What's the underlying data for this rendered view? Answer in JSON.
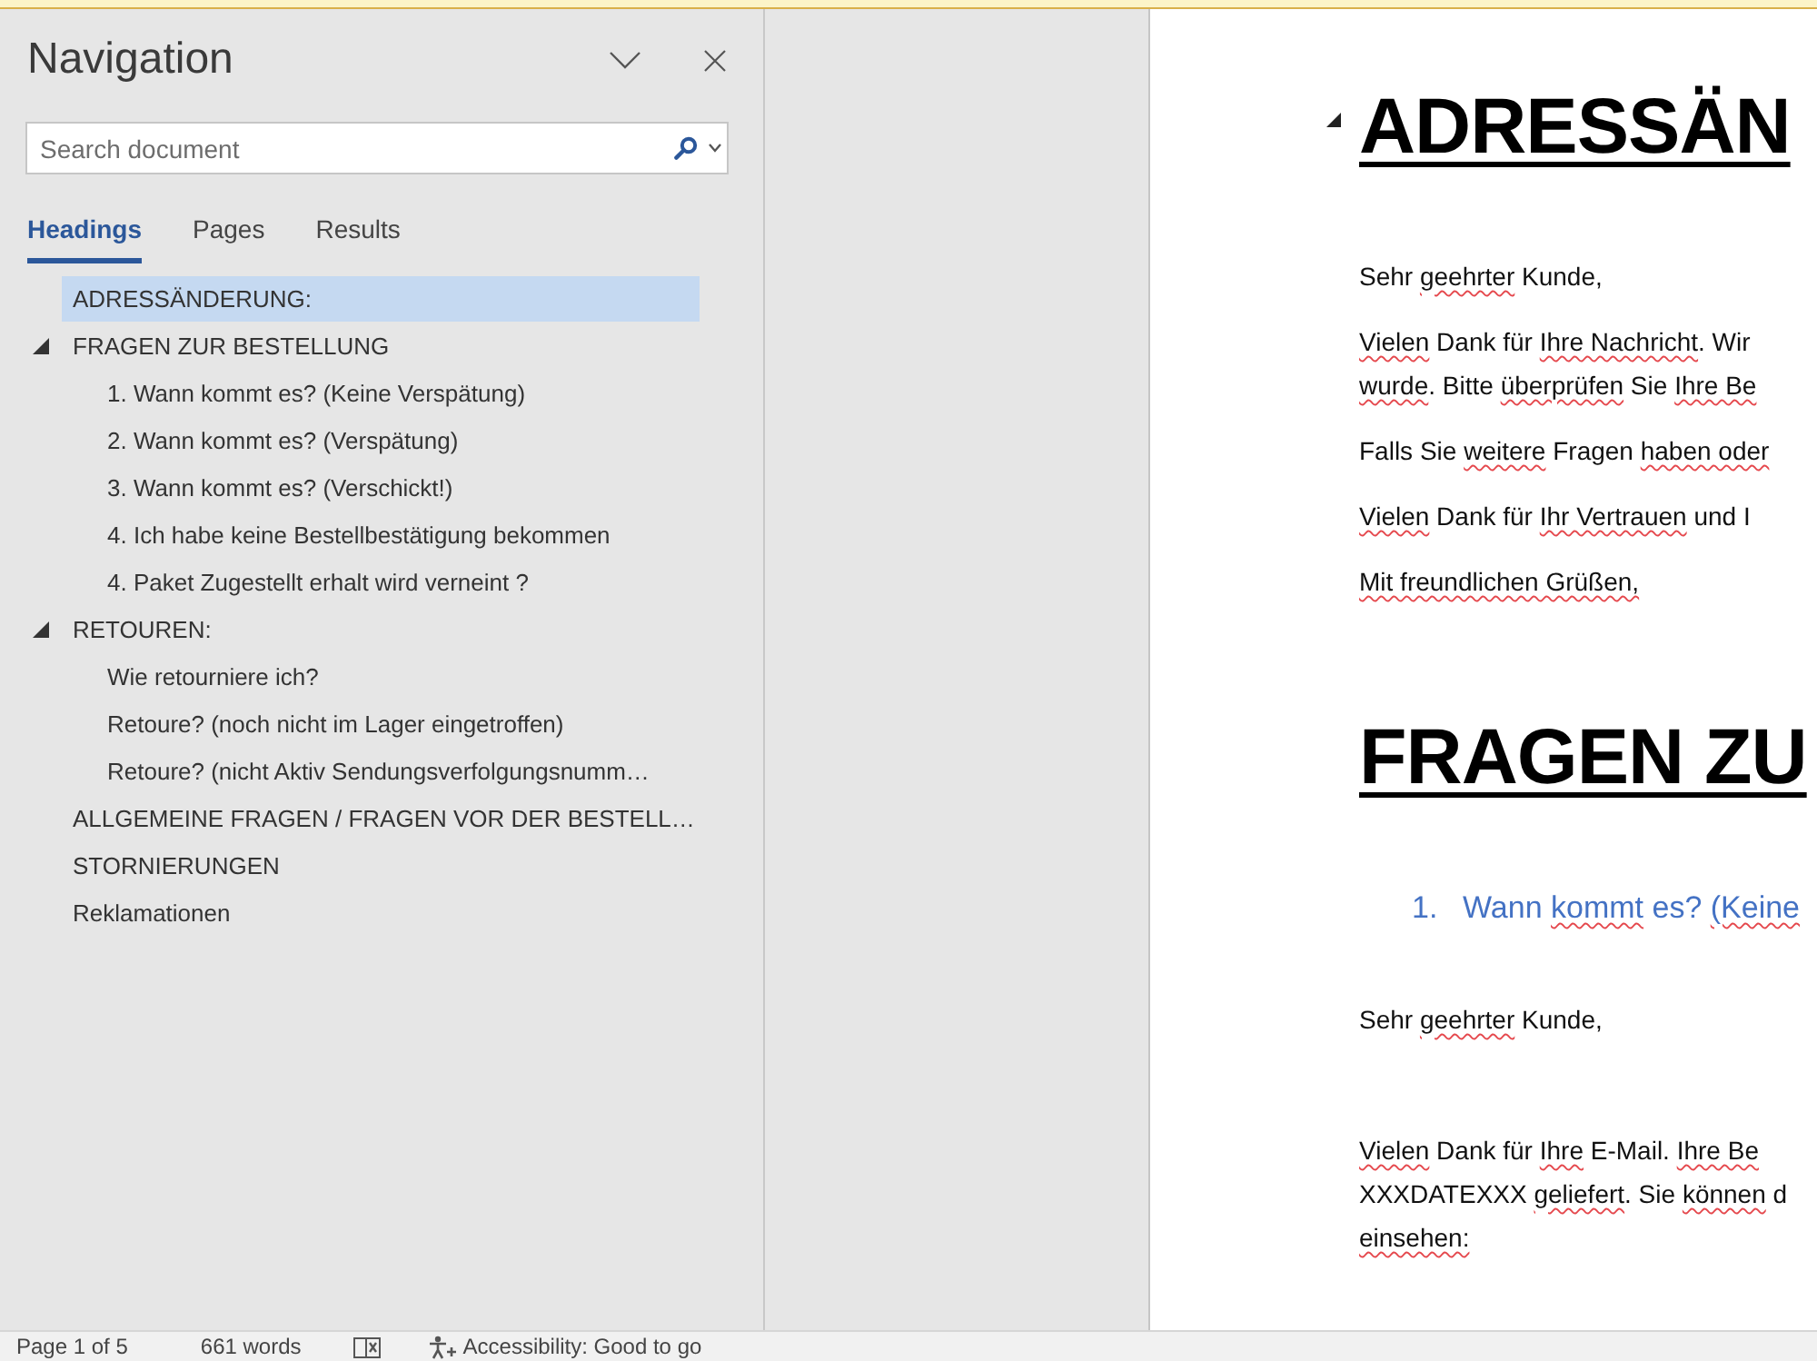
{
  "navigation": {
    "title": "Navigation",
    "search": {
      "placeholder": "Search document"
    },
    "tabs": [
      {
        "label": "Headings",
        "selected": true
      },
      {
        "label": "Pages",
        "selected": false
      },
      {
        "label": "Results",
        "selected": false
      }
    ],
    "headings": [
      {
        "text": "ADRESSÄNDERUNG:",
        "selected": true
      },
      {
        "text": "FRAGEN ZUR BESTELLUNG",
        "selected": false,
        "expanded": true,
        "children": [
          {
            "text": "1. Wann kommt es? (Keine Verspätung)",
            "selected": false
          },
          {
            "text": "2. Wann kommt es? (Verspätung)",
            "selected": false
          },
          {
            "text": "3. Wann kommt es? (Verschickt!)",
            "selected": false
          },
          {
            "text": "4. Ich habe keine Bestellbestätigung bekommen",
            "selected": false
          },
          {
            "text": "4. Paket Zugestellt erhalt wird verneint ?",
            "selected": false
          }
        ]
      },
      {
        "text": "RETOUREN:",
        "selected": false,
        "expanded": true,
        "children": [
          {
            "text": "Wie retourniere ich?",
            "selected": false
          },
          {
            "text": "Retoure? (noch nicht im Lager eingetroffen)",
            "selected": false
          },
          {
            "text": "Retoure? (nicht Aktiv Sendungsverfolgungsnumm…",
            "selected": false
          }
        ]
      },
      {
        "text": "ALLGEMEINE FRAGEN / FRAGEN VOR DER BESTELL…",
        "selected": false
      },
      {
        "text": "STORNIERUNGEN",
        "selected": false
      },
      {
        "text": "Reklamationen",
        "selected": false
      }
    ]
  },
  "document": {
    "blocks": [
      {
        "kind": "heading",
        "text": "ADRESSÄN",
        "collapse_arrow": true
      },
      {
        "kind": "paragraph",
        "blank_line_before": false,
        "lines": [
          [
            {
              "text": "Sehr ",
              "spelling_error": false
            },
            {
              "text": "geehrter",
              "spelling_error": true
            },
            {
              "text": " Kunde,",
              "spelling_error": false
            }
          ]
        ]
      },
      {
        "kind": "paragraph",
        "blank_line_before": false,
        "lines": [
          [
            {
              "text": "Vielen",
              "spelling_error": true
            },
            {
              "text": " Dank für ",
              "spelling_error": false
            },
            {
              "text": "Ihre Nachricht",
              "spelling_error": true
            },
            {
              "text": ". Wir",
              "spelling_error": false
            }
          ],
          [
            {
              "text": "wurde",
              "spelling_error": true
            },
            {
              "text": ". Bitte ",
              "spelling_error": false
            },
            {
              "text": "überprüfen",
              "spelling_error": true
            },
            {
              "text": " Sie ",
              "spelling_error": false
            },
            {
              "text": "Ihre Be",
              "spelling_error": true
            }
          ]
        ]
      },
      {
        "kind": "paragraph",
        "blank_line_before": false,
        "lines": [
          [
            {
              "text": "Falls Sie ",
              "spelling_error": false
            },
            {
              "text": "weitere",
              "spelling_error": true
            },
            {
              "text": " Fragen ",
              "spelling_error": false
            },
            {
              "text": "haben oder",
              "spelling_error": true
            }
          ]
        ]
      },
      {
        "kind": "paragraph",
        "blank_line_before": false,
        "lines": [
          [
            {
              "text": "Vielen",
              "spelling_error": true
            },
            {
              "text": " Dank für ",
              "spelling_error": false
            },
            {
              "text": "Ihr Vertrauen",
              "spelling_error": true
            },
            {
              "text": " und I",
              "spelling_error": false
            }
          ]
        ]
      },
      {
        "kind": "paragraph",
        "blank_line_before": false,
        "lines": [
          [
            {
              "text": "Mit freundlichen Grüßen,",
              "spelling_error": true
            }
          ]
        ]
      },
      {
        "kind": "heading",
        "text": "FRAGEN ZU",
        "collapse_arrow": false
      },
      {
        "kind": "numbered_heading",
        "number": "1.",
        "runs": [
          {
            "text": "Wann ",
            "spelling_error": false
          },
          {
            "text": "kommt",
            "spelling_error": true
          },
          {
            "text": " es? ",
            "spelling_error": false
          },
          {
            "text": "(Keine",
            "spelling_error": true
          }
        ]
      },
      {
        "kind": "paragraph",
        "blank_line_before": false,
        "lines": [
          [
            {
              "text": "Sehr ",
              "spelling_error": false
            },
            {
              "text": "geehrter",
              "spelling_error": true
            },
            {
              "text": " Kunde,",
              "spelling_error": false
            }
          ]
        ]
      },
      {
        "kind": "paragraph",
        "blank_line_before": true,
        "lines": [
          [
            {
              "text": "Vielen",
              "spelling_error": true
            },
            {
              "text": " Dank für ",
              "spelling_error": false
            },
            {
              "text": "Ihre",
              "spelling_error": true
            },
            {
              "text": " E-Mail. ",
              "spelling_error": false
            },
            {
              "text": "Ihre Be",
              "spelling_error": true
            }
          ],
          [
            {
              "text": "XXXDATEXXX ",
              "spelling_error": false
            },
            {
              "text": "geliefert",
              "spelling_error": true
            },
            {
              "text": ". Sie ",
              "spelling_error": false
            },
            {
              "text": "können",
              "spelling_error": true
            },
            {
              "text": " d",
              "spelling_error": false
            }
          ],
          [
            {
              "text": "einsehen:",
              "spelling_error": true
            }
          ]
        ]
      }
    ]
  },
  "status_bar": {
    "page": "Page 1 of 5",
    "words": "661 words",
    "accessibility": "Accessibility: Good to go"
  }
}
